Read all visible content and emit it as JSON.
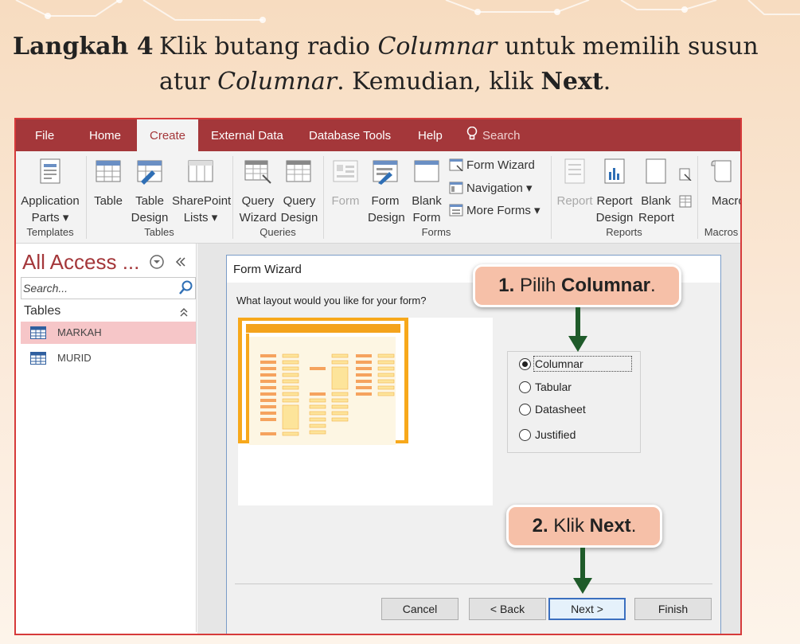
{
  "instruction": {
    "step": "Langkah 4",
    "line1_a": "Klik butang radio ",
    "line1_b": "Columnar",
    "line1_c": " untuk memilih susun",
    "line2_a": "atur ",
    "line2_b": "Columnar",
    "line2_c": ". Kemudian, klik ",
    "line2_d": "Next",
    "line2_e": "."
  },
  "tabs": [
    "File",
    "Home",
    "Create",
    "External Data",
    "Database Tools",
    "Help",
    "Search"
  ],
  "active_tab": "Create",
  "ribbon": {
    "templates": {
      "app_parts": [
        "Application",
        "Parts ▾"
      ],
      "label": "Templates"
    },
    "tables": {
      "table": "Table",
      "table_design": [
        "Table",
        "Design"
      ],
      "sharepoint": [
        "SharePoint",
        "Lists ▾"
      ],
      "label": "Tables"
    },
    "queries": {
      "wizard": [
        "Query",
        "Wizard"
      ],
      "design": [
        "Query",
        "Design"
      ],
      "label": "Queries"
    },
    "forms": {
      "form": "Form",
      "form_design": [
        "Form",
        "Design"
      ],
      "blank_form": [
        "Blank",
        "Form"
      ],
      "form_wizard": "Form Wizard",
      "navigation": "Navigation ▾",
      "more_forms": "More Forms ▾",
      "label": "Forms"
    },
    "reports": {
      "report": "Report",
      "report_design": [
        "Report",
        "Design"
      ],
      "blank_report": [
        "Blank",
        "Report"
      ],
      "label": "Reports"
    },
    "macros": {
      "macro": "Macro",
      "label": "Macros"
    }
  },
  "nav": {
    "title": "All Access ...",
    "search_placeholder": "Search...",
    "section": "Tables",
    "items": [
      "MARKAH",
      "MURID"
    ]
  },
  "dialog": {
    "title": "Form Wizard",
    "question": "What layout would you like for your form?",
    "options": [
      "Columnar",
      "Tabular",
      "Datasheet",
      "Justified"
    ],
    "selected": "Columnar",
    "buttons": {
      "cancel": "Cancel",
      "back": "< Back",
      "next": "Next >",
      "finish": "Finish"
    }
  },
  "callouts": {
    "c1_num": "1.",
    "c1_text": " Pilih ",
    "c1_bold": "Columnar",
    "c1_end": ".",
    "c2_num": "2.",
    "c2_text": " Klik ",
    "c2_bold": "Next",
    "c2_end": "."
  },
  "colors": {
    "accent": "#a4373a",
    "callout": "#f6c0a8",
    "arrow": "#1f5b2a",
    "preview": "#f6a81e"
  }
}
